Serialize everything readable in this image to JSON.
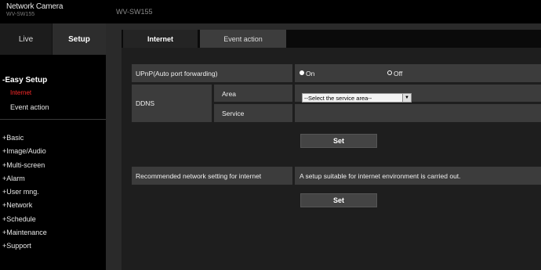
{
  "header": {
    "brand": "Network Camera",
    "brand_sub": "WV-SW155",
    "model": "WV-SW155"
  },
  "sidebar": {
    "tab_live": "Live",
    "tab_setup": "Setup",
    "easy_setup": "-Easy Setup",
    "internet": "Internet",
    "event_action": "Event action",
    "menu": [
      "+Basic",
      "+Image/Audio",
      "+Multi-screen",
      "+Alarm",
      "+User mng.",
      "+Network",
      "+Schedule",
      "+Maintenance",
      "+Support"
    ]
  },
  "tabs": {
    "internet": "Internet",
    "event_action": "Event action"
  },
  "form": {
    "upnp_label": "UPnP(Auto port forwarding)",
    "on_label": "On",
    "off_label": "Off",
    "upnp_selected": "On",
    "ddns_label": "DDNS",
    "area_label": "Area",
    "area_select_value": "--Select the service area--",
    "service_label": "Service",
    "set_label_1": "Set",
    "recommended_label": "Recommended network setting for internet",
    "recommended_desc": "A setup suitable for internet environment is carried out.",
    "set_label_2": "Set"
  },
  "icons": {
    "dropdown": "chevron-down-icon",
    "radio_on": "radio-selected-icon",
    "radio_off": "radio-unselected-icon"
  },
  "colors": {
    "active_link": "#ff2a2a",
    "background": "#000000",
    "panel": "#1e1e1e",
    "cell": "#3c3c3c"
  }
}
